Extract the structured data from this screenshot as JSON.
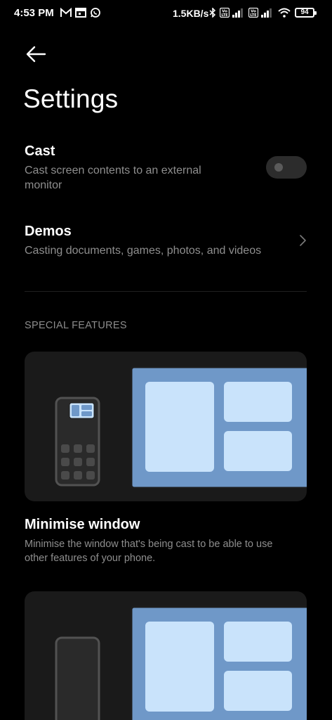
{
  "status_bar": {
    "time": "4:53 PM",
    "net_speed": "1.5KB/s",
    "battery": "94",
    "icons": [
      "gmail-icon",
      "calendar-icon",
      "whatsapp-icon",
      "bluetooth-icon",
      "volte-icon",
      "signal-icon",
      "volte-icon",
      "signal-icon",
      "wifi-icon",
      "battery-icon"
    ]
  },
  "header": {
    "title": "Settings",
    "back_icon": "arrow-left-icon"
  },
  "cast": {
    "title": "Cast",
    "subtitle_line1": "Cast screen contents to an external",
    "subtitle_line2": "monitor",
    "toggle_on": false
  },
  "demos": {
    "title": "Demos",
    "subtitle": "Casting documents, games, photos, and videos",
    "chevron_icon": "chevron-right-icon"
  },
  "special_features": {
    "header": "SPECIAL FEATURES",
    "items": [
      {
        "title": "Minimise window",
        "desc_line1": "Minimise the window that's being cast to be able to use",
        "desc_line2": "other features of your phone."
      }
    ]
  },
  "colors": {
    "background": "#000000",
    "card_bg": "#1a1a1a",
    "monitor_blue": "#6f98c8",
    "window_light": "#c9e3fb",
    "secondary_text": "#8e8e8e"
  }
}
